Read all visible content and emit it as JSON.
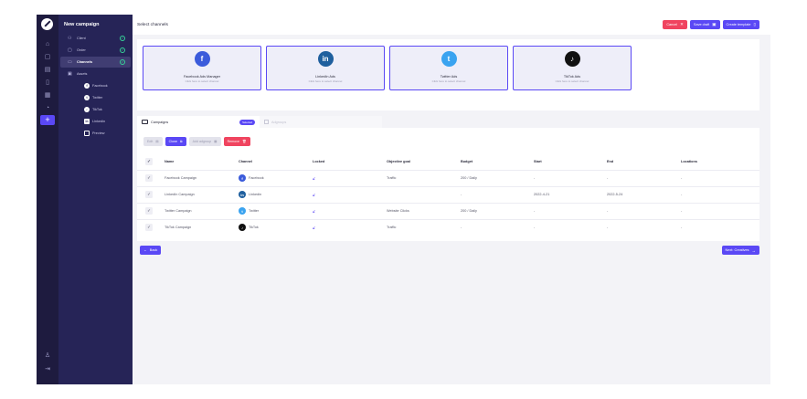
{
  "header": {
    "campaign_title": "New campaign",
    "page_title": "Select channels",
    "cancel_label": "Cancel",
    "save_draft_label": "Save draft",
    "create_template_label": "Create template"
  },
  "sidebar": {
    "items": [
      {
        "label": "Client",
        "icon": "users-icon",
        "done": true
      },
      {
        "label": "Order",
        "icon": "order-icon",
        "done": true
      },
      {
        "label": "Channels",
        "icon": "channels-icon",
        "done": true
      },
      {
        "label": "Assets",
        "icon": "assets-icon",
        "done": false
      }
    ],
    "channel_items": [
      {
        "label": "Facebook",
        "glyph": "f"
      },
      {
        "label": "Twitter",
        "glyph": "t"
      },
      {
        "label": "TikTok",
        "glyph": "♪"
      },
      {
        "label": "Linkedin",
        "glyph": "in"
      },
      {
        "label": "Preview",
        "glyph": ""
      }
    ]
  },
  "channels": [
    {
      "name": "Facebook Ads Manager",
      "hint": "Click here to select channel",
      "glyph": "f",
      "color": "#3b5bdb"
    },
    {
      "name": "LinkedIn Ads",
      "hint": "Click here to select channel",
      "glyph": "in",
      "color": "#1f5f9e"
    },
    {
      "name": "Twitter Ads",
      "hint": "Click here to select channel",
      "glyph": "t",
      "color": "#3aa3f0"
    },
    {
      "name": "TikTok Ads",
      "hint": "Click here to select channel",
      "glyph": "♪",
      "color": "#111111"
    }
  ],
  "tabs": {
    "active_label": "Campaigns",
    "active_badge": "Selected",
    "inactive_label": "Adgroups"
  },
  "actions": {
    "edit_label": "Edit",
    "clone_label": "Clone",
    "add_adgroup_label": "Add adgroup",
    "remove_label": "Remove"
  },
  "table": {
    "columns": [
      "Name",
      "Channel",
      "Locked",
      "Objective goal",
      "Budget",
      "Start",
      "End",
      "Locations"
    ],
    "rows": [
      {
        "name": "Facebook Campaign",
        "channel": "Facebook",
        "glyph": "f",
        "color": "#3b5bdb",
        "objective": "Traffic",
        "budget": "200 / Daily",
        "start": "-",
        "end": "-",
        "locations": "-"
      },
      {
        "name": "LinkedIn Campaign",
        "channel": "Linkedin",
        "glyph": "in",
        "color": "#1f5f9e",
        "objective": "",
        "budget": "-",
        "start": "2022-4-21",
        "end": "2022-5-24",
        "locations": "-"
      },
      {
        "name": "Twitter Campaign",
        "channel": "Twitter",
        "glyph": "t",
        "color": "#3aa3f0",
        "objective": "Website Clicks",
        "budget": "200 / Daily",
        "start": "-",
        "end": "-",
        "locations": "-"
      },
      {
        "name": "TikTok Campaign",
        "channel": "TikTok",
        "glyph": "♪",
        "color": "#111111",
        "objective": "Traffic",
        "budget": "-",
        "start": "-",
        "end": "-",
        "locations": "-"
      }
    ]
  },
  "footer": {
    "back_label": "Back",
    "next_label": "Next: Creatives"
  },
  "colors": {
    "accent": "#5a48f5",
    "danger": "#f0445f",
    "sidebar_bg": "#262457",
    "rail_bg": "#1e1b3f",
    "success": "#36d399"
  }
}
